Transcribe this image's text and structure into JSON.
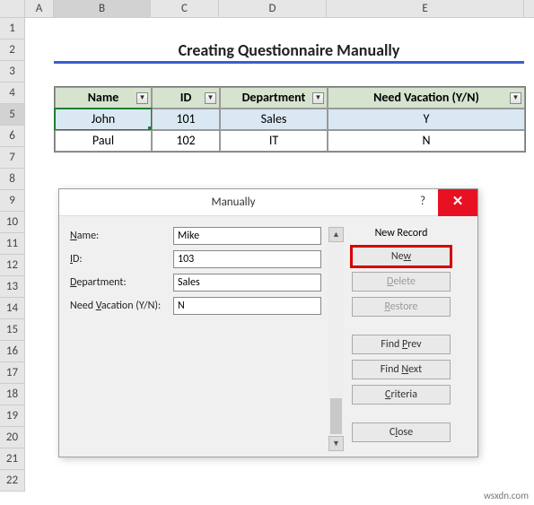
{
  "columns": [
    "A",
    "B",
    "C",
    "D",
    "E"
  ],
  "rows": [
    "1",
    "2",
    "3",
    "4",
    "5",
    "6",
    "7",
    "8",
    "9",
    "10",
    "11",
    "12",
    "13",
    "14",
    "15",
    "16",
    "17",
    "18",
    "19",
    "20",
    "21",
    "22"
  ],
  "selected_col": "B",
  "selected_row": "5",
  "title": "Creating Questionnaire Manually",
  "table": {
    "headers": {
      "name": "Name",
      "id": "ID",
      "dept": "Department",
      "vac": "Need Vacation (Y/N)"
    },
    "rows": [
      {
        "name": "John",
        "id": "101",
        "dept": "Sales",
        "vac": "Y"
      },
      {
        "name": "Paul",
        "id": "102",
        "dept": "IT",
        "vac": "N"
      }
    ]
  },
  "dialog": {
    "title": "Manually",
    "help": "?",
    "close": "✕",
    "status": "New Record",
    "labels": {
      "name": "Name:",
      "id": "ID:",
      "dept": "Department:",
      "vac": "Need Vacation (Y/N):"
    },
    "underlines": {
      "name": "N",
      "id": "I",
      "dept": "D",
      "vac": "V"
    },
    "values": {
      "name": "Mike",
      "id": "103",
      "dept": "Sales",
      "vac": "N"
    },
    "buttons": {
      "new": "New",
      "new_u": "w",
      "delete": "Delete",
      "delete_u": "D",
      "restore": "Restore",
      "restore_u": "R",
      "findprev": "Find Prev",
      "findprev_u": "P",
      "findnext": "Find Next",
      "findnext_u": "N",
      "criteria": "Criteria",
      "criteria_u": "C",
      "close": "Close",
      "close_u": "l"
    }
  },
  "watermark": "wsxdn.com"
}
